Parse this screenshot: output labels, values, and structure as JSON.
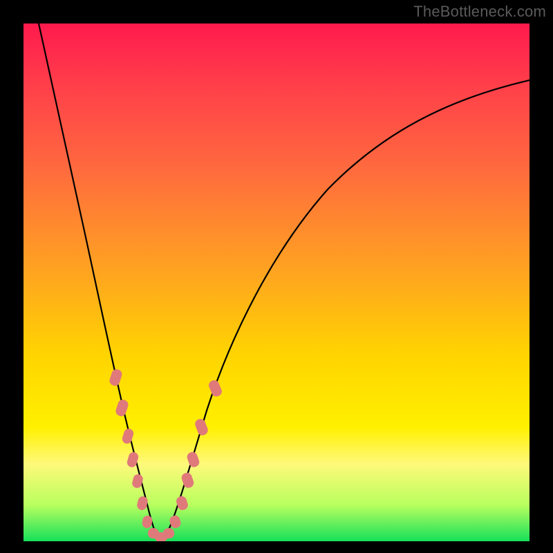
{
  "watermark": "TheBottleneck.com",
  "colors": {
    "frame": "#000000",
    "gradient_top": "#ff1a4d",
    "gradient_bottom": "#16e05a",
    "curve": "#000000",
    "dots": "#e07a7a"
  },
  "chart_data": {
    "type": "line",
    "title": "",
    "xlabel": "",
    "ylabel": "",
    "xlim": [
      0,
      100
    ],
    "ylim": [
      0,
      100
    ],
    "axes_visible": false,
    "grid": false,
    "legend": null,
    "series": [
      {
        "name": "bottleneck-curve",
        "x": [
          3,
          6,
          9,
          12,
          15,
          17,
          19,
          20.5,
          22,
          23,
          24,
          25,
          26,
          27,
          28,
          30,
          34,
          40,
          48,
          56,
          66,
          78,
          90,
          100
        ],
        "y": [
          100,
          88,
          74,
          60,
          46,
          36,
          27,
          20,
          13,
          8,
          4,
          1,
          0,
          1,
          4,
          10,
          22,
          38,
          52,
          63,
          72,
          79,
          84,
          87
        ]
      }
    ],
    "scatter_points": {
      "name": "sample-dots",
      "description": "pink rounded markers clustered near the minimum of the curve",
      "points": [
        {
          "x": 18.0,
          "y": 32
        },
        {
          "x": 19.3,
          "y": 26
        },
        {
          "x": 20.2,
          "y": 20
        },
        {
          "x": 21.0,
          "y": 15
        },
        {
          "x": 21.8,
          "y": 11
        },
        {
          "x": 22.6,
          "y": 7
        },
        {
          "x": 23.6,
          "y": 3.5
        },
        {
          "x": 24.6,
          "y": 1.3
        },
        {
          "x": 25.6,
          "y": 0.7
        },
        {
          "x": 26.6,
          "y": 1.4
        },
        {
          "x": 27.8,
          "y": 3.6
        },
        {
          "x": 29.2,
          "y": 8
        },
        {
          "x": 30.4,
          "y": 12
        },
        {
          "x": 31.5,
          "y": 16
        },
        {
          "x": 33.2,
          "y": 22
        },
        {
          "x": 35.8,
          "y": 29
        }
      ]
    },
    "annotations": [
      {
        "text": "TheBottleneck.com",
        "position": "top-right"
      }
    ]
  }
}
